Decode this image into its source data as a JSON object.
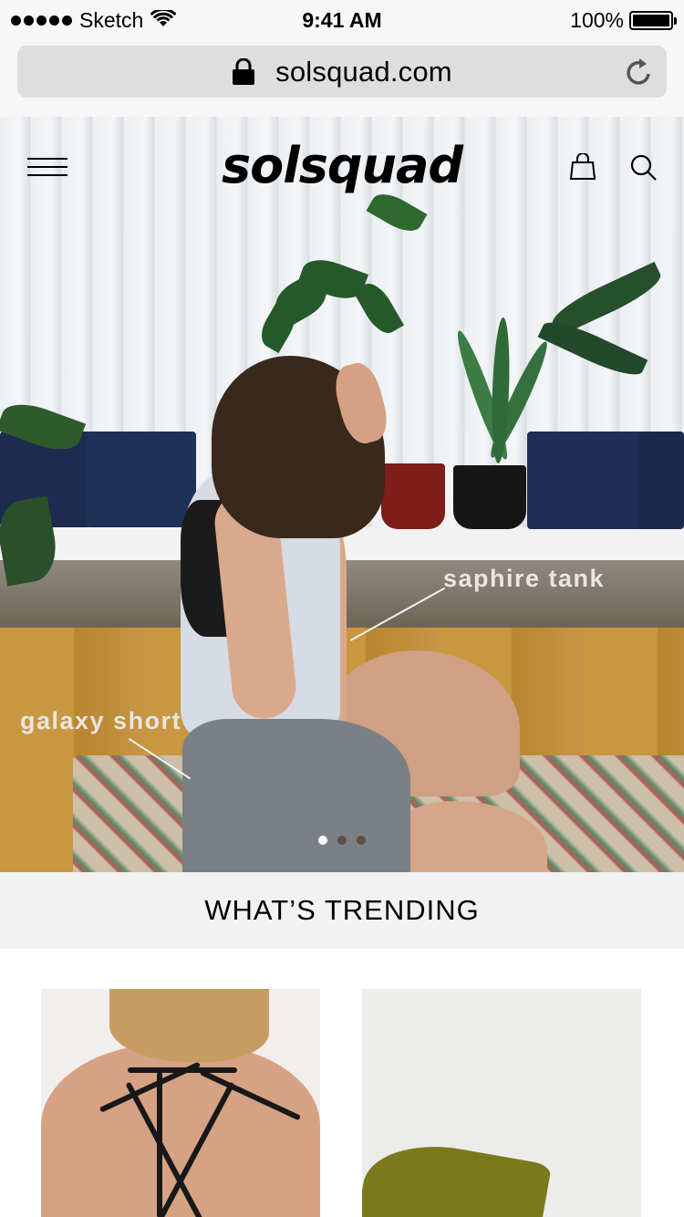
{
  "status_bar": {
    "carrier": "Sketch",
    "time": "9:41 AM",
    "battery_percent": "100%"
  },
  "browser": {
    "url": "solsquad.com"
  },
  "header": {
    "logo": "solsquad"
  },
  "hero": {
    "tag_tank": "saphire tank",
    "tag_short": "galaxy short",
    "carousel": {
      "count": 3,
      "active_index": 0
    }
  },
  "trending": {
    "title": "WHAT’S TRENDING"
  }
}
